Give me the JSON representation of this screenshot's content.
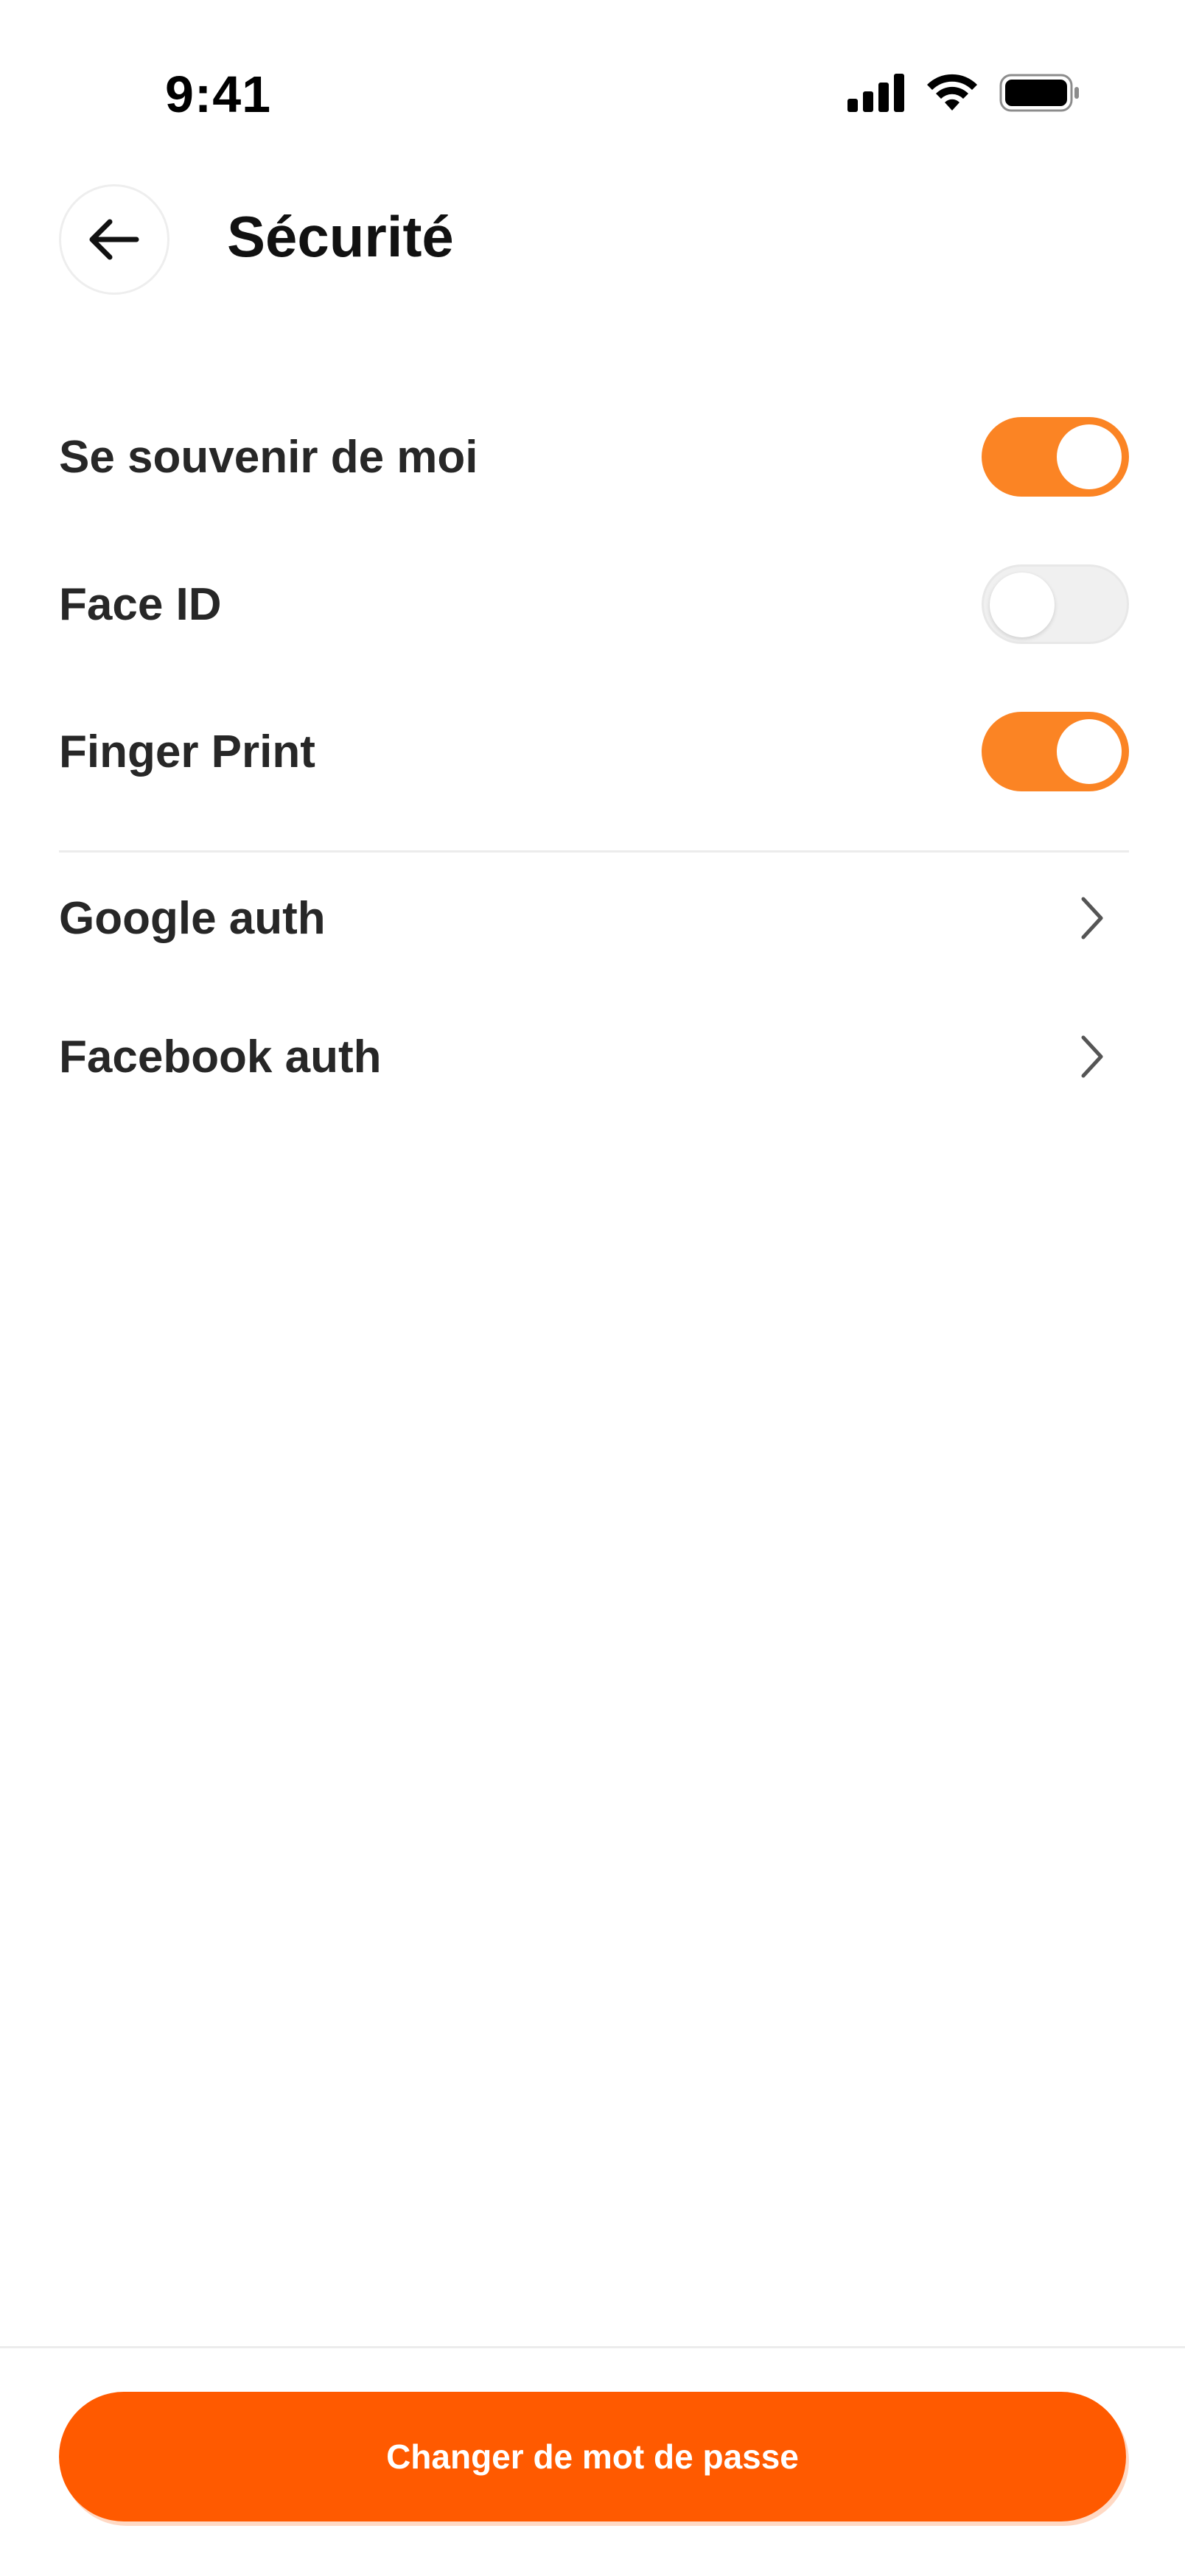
{
  "status_bar": {
    "time": "9:41",
    "icons": [
      "cellular-signal-icon",
      "wifi-icon",
      "battery-icon"
    ]
  },
  "header": {
    "back_icon": "arrow-left-icon",
    "title": "Sécurité"
  },
  "settings": {
    "toggles": [
      {
        "label": "Se souvenir de moi",
        "enabled": true
      },
      {
        "label": "Face ID",
        "enabled": false
      },
      {
        "label": "Finger Print",
        "enabled": true
      }
    ],
    "links": [
      {
        "label": "Google auth",
        "icon": "chevron-right-icon"
      },
      {
        "label": "Facebook auth",
        "icon": "chevron-right-icon"
      }
    ]
  },
  "footer": {
    "button_label": "Changer de mot de passe"
  },
  "colors": {
    "accent": "#fb8424",
    "primary_button": "#ff5a00",
    "toggle_off": "#f0f0f0"
  }
}
